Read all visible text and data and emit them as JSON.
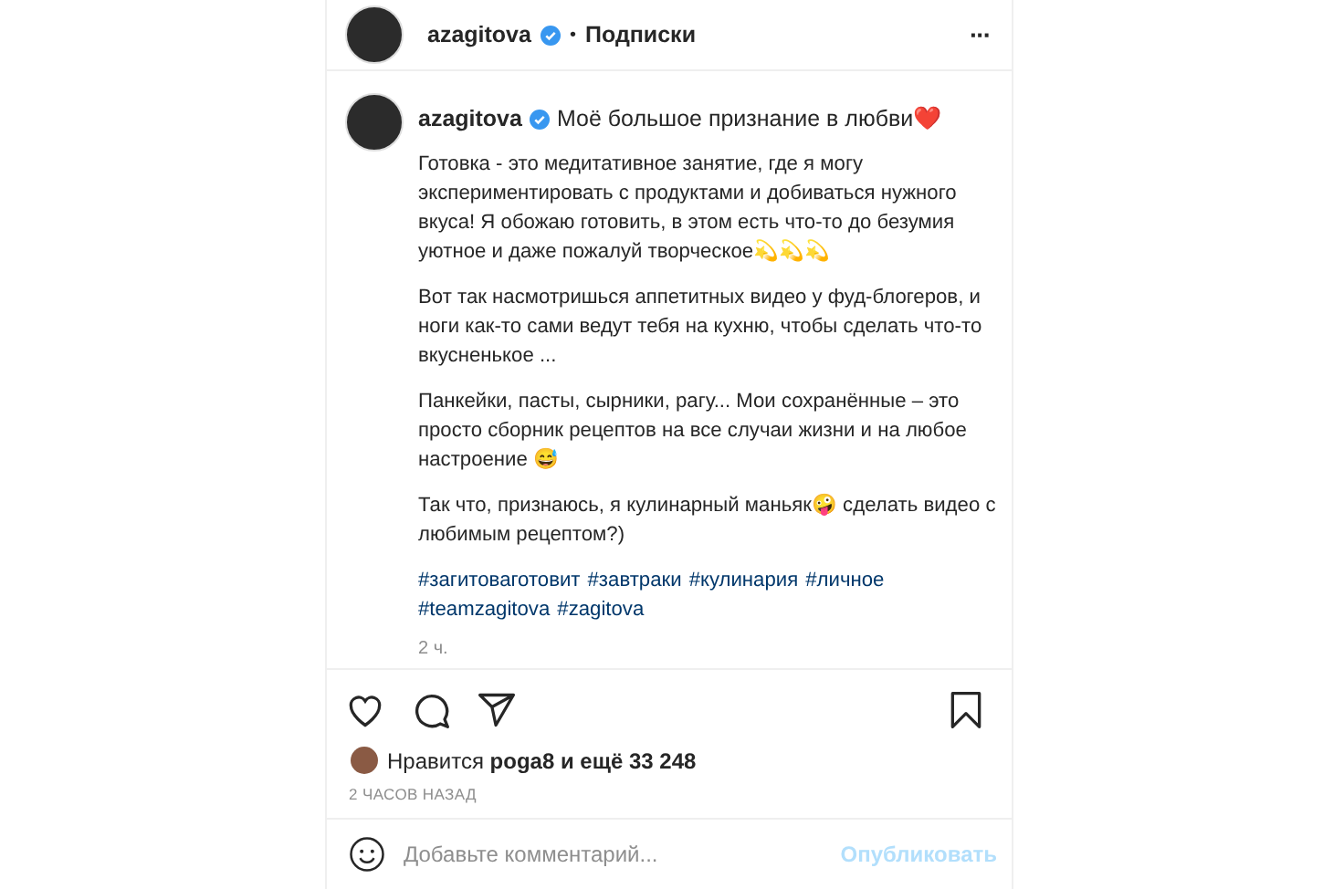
{
  "header": {
    "username": "azagitova",
    "verified": true,
    "separator": "•",
    "follow_label": "Подписки",
    "more": "···"
  },
  "caption": {
    "username": "azagitova",
    "verified": true,
    "title": "Моё большое признание в любви❤️",
    "paragraphs": [
      "Готовка - это медитативное занятие, где я могу экспериментировать с продуктами и добиваться нужного вкуса! Я обожаю готовить, в этом есть что-то до безумия уютное и даже пожалуй творческое💫💫💫",
      "Вот так насмотришься аппетитных видео у фуд-блогеров, и ноги как-то сами ведут тебя на кухню, чтобы сделать что-то вкусненькое ...",
      "Панкейки, пасты, сырники, рагу... Мои сохранённые – это просто сборник рецептов на все случаи жизни и на любое настроение 😅",
      "Так что, признаюсь, я кулинарный маньяк🤪 сделать видео с любимым рецептом?)"
    ],
    "hashtags": [
      "#загитоваготовит",
      "#завтраки",
      "#кулинария",
      "#личное",
      "#teamzagitova",
      "#zagitova"
    ],
    "age": "2 ч."
  },
  "actions": {
    "liked": false,
    "saved": false
  },
  "likes": {
    "prefix": "Нравится",
    "text": "**poga8 и ещё 33 248**"
  },
  "timestamp": "2 ЧАСОВ НАЗАД",
  "comment": {
    "placeholder": "Добавьте комментарий...",
    "submit": "Опубликовать",
    "submit_disabled": true
  }
}
